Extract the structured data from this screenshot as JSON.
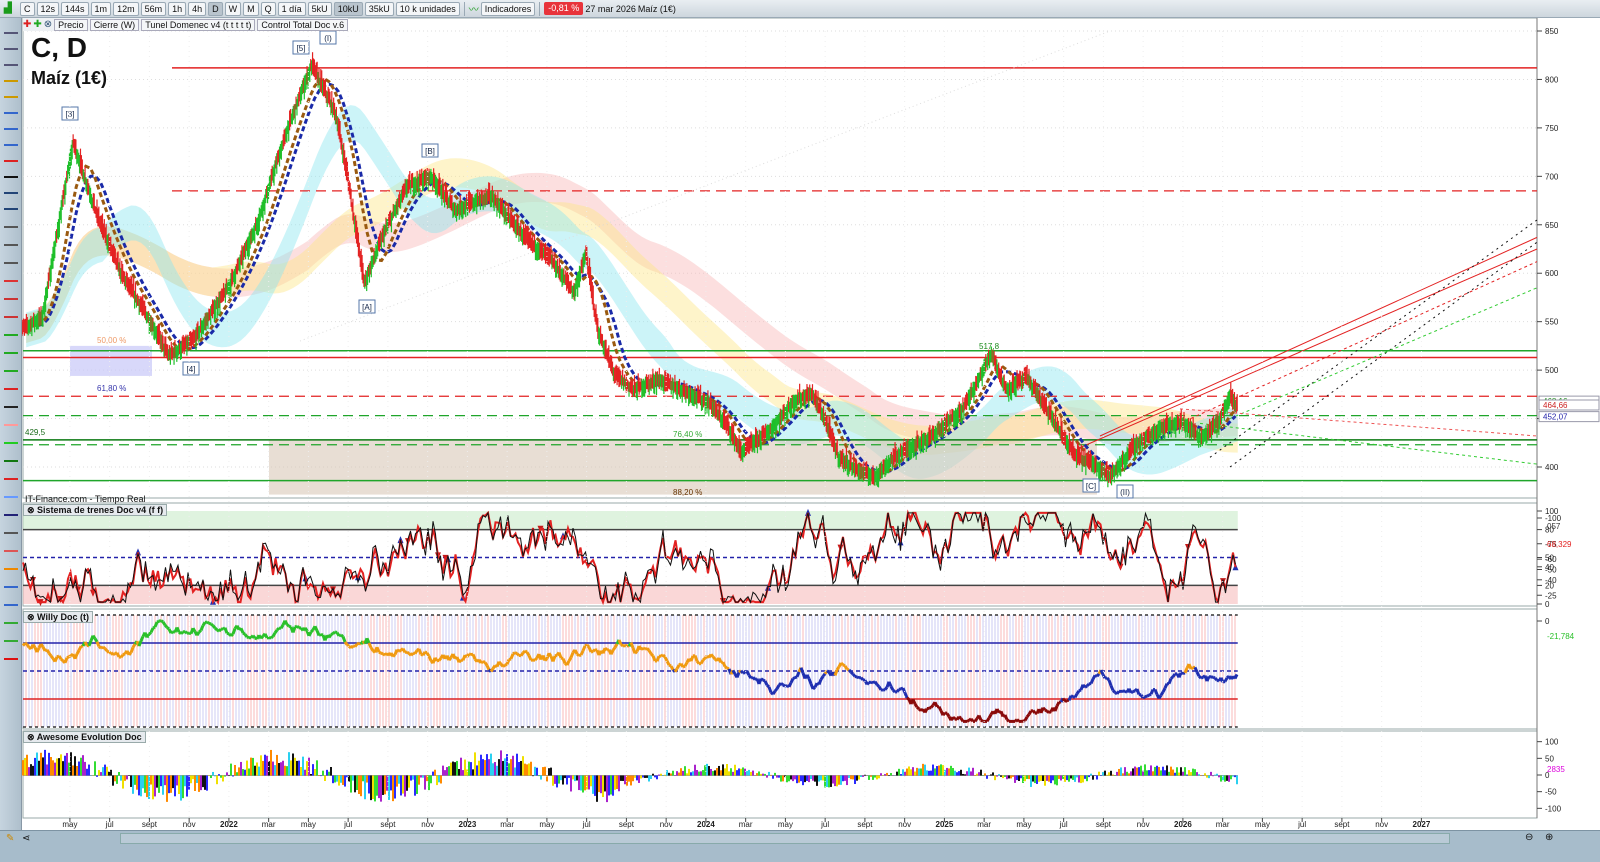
{
  "toolbar": {
    "symbol": "C",
    "intervals": [
      "12s",
      "144s",
      "1m",
      "12m",
      "56m",
      "1h",
      "4h",
      "D",
      "W",
      "M",
      "Q"
    ],
    "period": "1 día",
    "units": [
      "5kU",
      "10kU",
      "35kU"
    ],
    "units_select": "10 k unidades",
    "indicators": "Indicadores",
    "change": "-0,81 %",
    "date": "27 mar 2026",
    "instrument": "Maíz (1€)"
  },
  "legend": {
    "price": "Precio",
    "close": "Cierre (W)",
    "tunnel": "Tunel Domenec v4 (t t t t t)",
    "control": "Control Total Doc v.6"
  },
  "main": {
    "title": "C, D",
    "subtitle": "Maíz (1€)",
    "source": "IT-Finance.com - Tiempo Real",
    "wave_labels": [
      "[3]",
      "[5]",
      "(I)",
      "[B]",
      "[A]",
      "[4]",
      "[C]",
      "(II)"
    ],
    "level_labels": {
      "fib50": "50,00 %",
      "fib618": "61,80 %",
      "fib764": "76,40 %",
      "fib882": "88,20 %",
      "low": "429,5",
      "high": "517,8"
    },
    "price_tags": {
      "a": "468,16",
      "b": "464,66",
      "c": "452,07"
    },
    "colors": {
      "up": "#1fbf2a",
      "down": "#e32222",
      "accent": "#e8343b"
    }
  },
  "panels": {
    "trenes": {
      "title": "Sistema de trenes Doc v4 (f f)",
      "ticks": [
        "100",
        "80",
        "50",
        "40",
        "20",
        "0"
      ],
      "tags": [
        "057",
        "68,329"
      ]
    },
    "willy": {
      "title": "Willy Doc (t)",
      "ticks": [
        "0",
        "-25",
        "-40",
        "-50",
        "-60",
        "-75",
        "-100"
      ],
      "tags": [
        "-21,784"
      ]
    },
    "awesome": {
      "title": "Awesome Evolution Doc",
      "ticks": [
        "100",
        "50",
        "0",
        "-50",
        "-100"
      ],
      "tags": [
        "2835"
      ]
    }
  },
  "xaxis": [
    "may",
    "jul",
    "sept",
    "nov",
    "2022",
    "mar",
    "may",
    "jul",
    "sept",
    "nov",
    "2023",
    "mar",
    "may",
    "jul",
    "sept",
    "nov",
    "2024",
    "mar",
    "may",
    "jul",
    "sept",
    "nov",
    "2025",
    "mar",
    "may",
    "jul",
    "sept",
    "nov",
    "2026",
    "mar",
    "may",
    "jul",
    "sept",
    "nov",
    "2027"
  ],
  "chart_data": {
    "type": "line",
    "title": "C, D",
    "ylim": [
      380,
      860
    ],
    "yticks": [
      400,
      450,
      500,
      550,
      600,
      650,
      700,
      750,
      800,
      850
    ],
    "price": [
      [
        2021.12,
        540
      ],
      [
        2021.22,
        555
      ],
      [
        2021.35,
        735
      ],
      [
        2021.45,
        660
      ],
      [
        2021.55,
        600
      ],
      [
        2021.65,
        560
      ],
      [
        2021.75,
        515
      ],
      [
        2021.85,
        530
      ],
      [
        2022.0,
        585
      ],
      [
        2022.12,
        650
      ],
      [
        2022.25,
        750
      ],
      [
        2022.35,
        815
      ],
      [
        2022.45,
        765
      ],
      [
        2022.5,
        700
      ],
      [
        2022.57,
        590
      ],
      [
        2022.65,
        640
      ],
      [
        2022.75,
        690
      ],
      [
        2022.85,
        700
      ],
      [
        2022.95,
        665
      ],
      [
        2023.1,
        680
      ],
      [
        2023.25,
        635
      ],
      [
        2023.35,
        615
      ],
      [
        2023.45,
        580
      ],
      [
        2023.5,
        620
      ],
      [
        2023.55,
        540
      ],
      [
        2023.62,
        495
      ],
      [
        2023.7,
        480
      ],
      [
        2023.8,
        490
      ],
      [
        2023.92,
        478
      ],
      [
        2024.02,
        465
      ],
      [
        2024.1,
        440
      ],
      [
        2024.15,
        415
      ],
      [
        2024.28,
        440
      ],
      [
        2024.38,
        470
      ],
      [
        2024.45,
        475
      ],
      [
        2024.5,
        450
      ],
      [
        2024.56,
        410
      ],
      [
        2024.65,
        395
      ],
      [
        2024.71,
        390
      ],
      [
        2024.8,
        412
      ],
      [
        2024.95,
        432
      ],
      [
        2025.08,
        460
      ],
      [
        2025.15,
        492
      ],
      [
        2025.2,
        518
      ],
      [
        2025.26,
        480
      ],
      [
        2025.35,
        492
      ],
      [
        2025.45,
        452
      ],
      [
        2025.55,
        412
      ],
      [
        2025.65,
        400
      ],
      [
        2025.7,
        390
      ],
      [
        2025.8,
        422
      ],
      [
        2025.92,
        442
      ],
      [
        2026.0,
        446
      ],
      [
        2026.08,
        430
      ],
      [
        2026.15,
        446
      ],
      [
        2026.2,
        472
      ],
      [
        2026.23,
        462
      ]
    ],
    "hlines": [
      {
        "price": 812,
        "color": "#e32222",
        "style": "solid"
      },
      {
        "price": 685,
        "color": "#e32222",
        "style": "dash"
      },
      {
        "price": 520,
        "color": "#1fa52a",
        "style": "solid"
      },
      {
        "price": 513,
        "color": "#e32222",
        "style": "solid"
      },
      {
        "price": 473,
        "color": "#e32222",
        "style": "dash"
      },
      {
        "price": 453,
        "color": "#1fa52a",
        "style": "dash"
      },
      {
        "price": 428,
        "color": "#0b7a12",
        "style": "solid"
      },
      {
        "price": 423,
        "color": "#1fa52a",
        "style": "dash"
      },
      {
        "price": 386,
        "color": "#1fa52a",
        "style": "solid"
      }
    ]
  }
}
